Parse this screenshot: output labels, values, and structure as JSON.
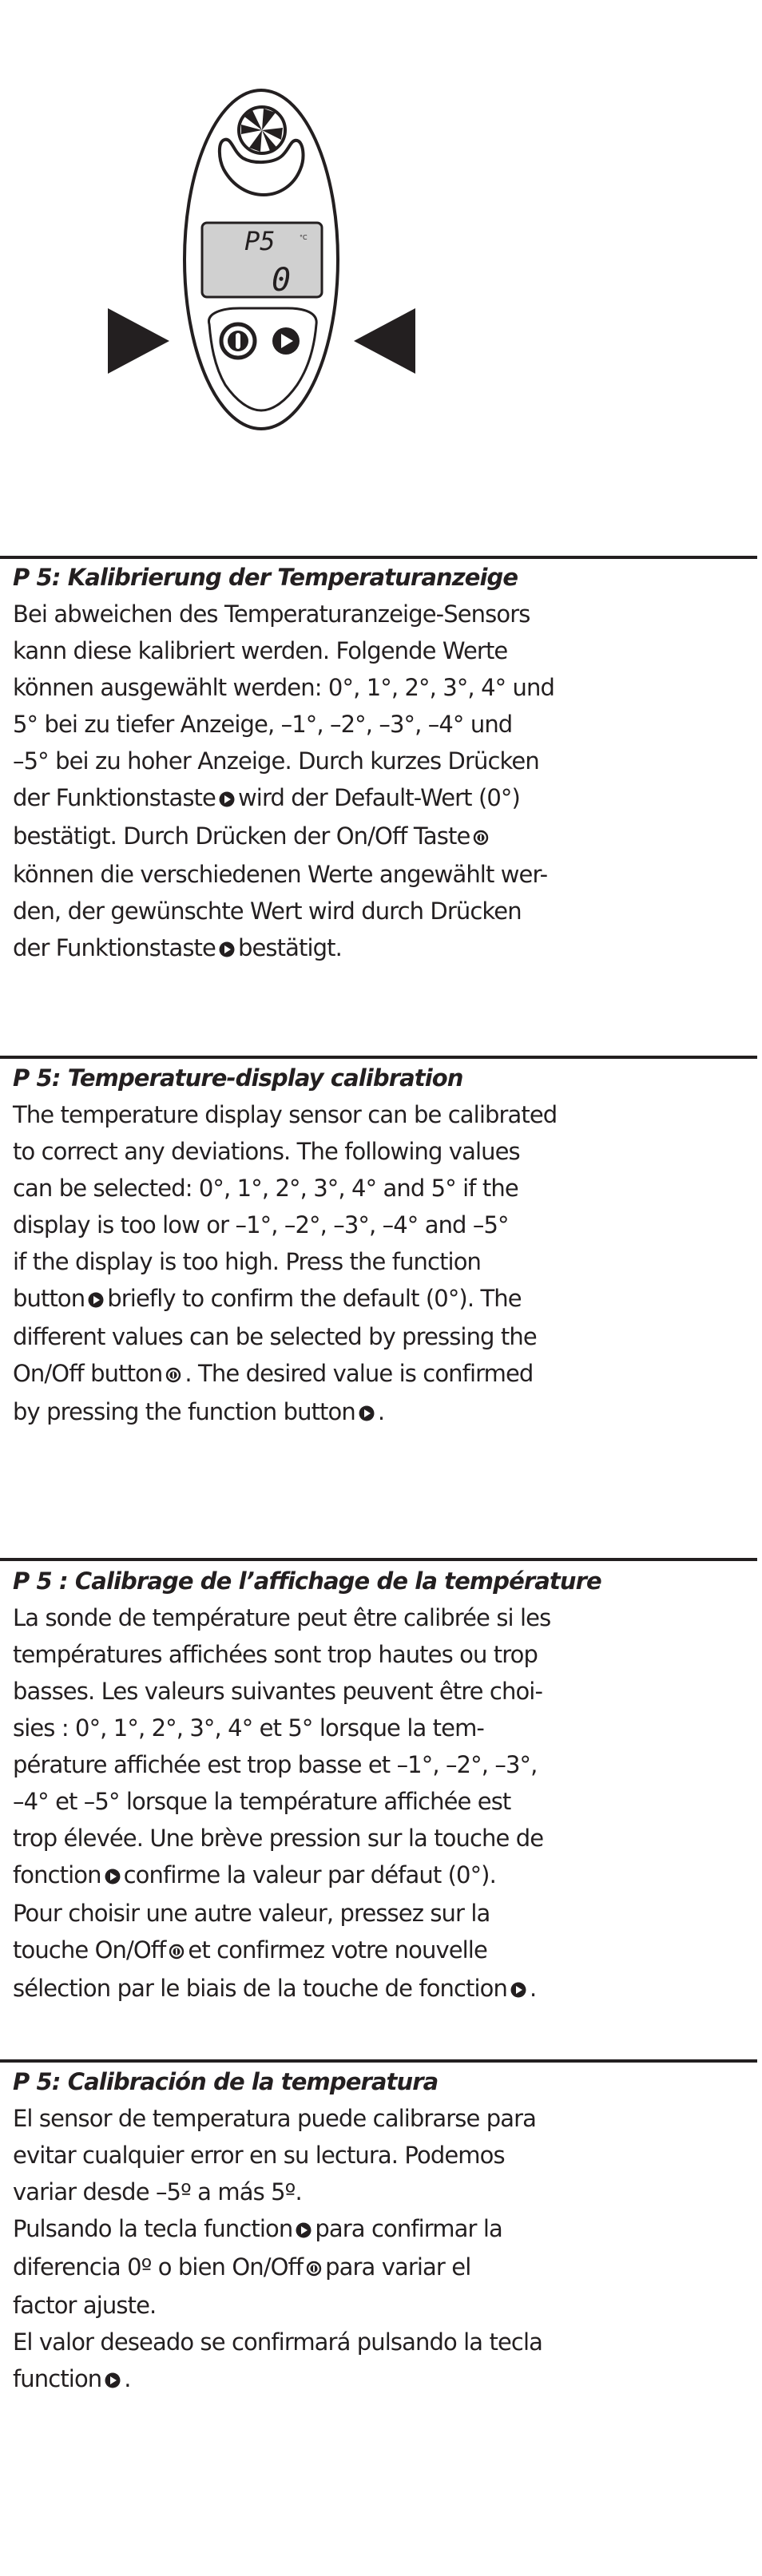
{
  "figure": {
    "lcd_top": "P5",
    "lcd_unit": "°C",
    "lcd_bottom": "0",
    "lcd_color": "#d0d0d0",
    "ink_color": "#231f20"
  },
  "icons": {
    "function_button": "function-button-icon",
    "onoff_button": "onoff-button-icon"
  },
  "sections": [
    {
      "lang": "de",
      "title": "P 5:  Kalibrierung der Temperaturanzeige",
      "lines": [
        [
          "Bei abweichen des Temperaturanzeige-Sensors"
        ],
        [
          "kann diese kalibriert werden. Folgende Werte"
        ],
        [
          "können ausgewählt werden: 0°, 1°, 2°, 3°, 4° und"
        ],
        [
          "5° bei zu tiefer Anzeige, –1°, –2°, –3°, –4° und"
        ],
        [
          "–5° bei zu hoher Anzeige. Durch kurzes Drücken"
        ],
        [
          "der Funktionstaste",
          "{fn}",
          "wird der Default-Wert (0°)"
        ],
        [
          "bestätigt. Durch Drücken der On/Off Taste",
          "{onoff}"
        ],
        [
          "können die verschiedenen Werte angewählt wer-"
        ],
        [
          "den, der gewünschte Wert wird durch Drücken"
        ],
        [
          "der Funktionstaste",
          "{fn}",
          "bestätigt."
        ]
      ]
    },
    {
      "lang": "en",
      "title": "P 5:  Temperature-display calibration",
      "lines": [
        [
          "The temperature display sensor can be calibrated"
        ],
        [
          "to correct any deviations. The following values"
        ],
        [
          "can be selected: 0°, 1°, 2°, 3°, 4° and 5° if the"
        ],
        [
          "display is too low or –1°, –2°, –3°, –4° and –5°"
        ],
        [
          "if the display is too high. Press the function"
        ],
        [
          "button",
          "{fn}",
          "briefly to confirm the default (0°). The"
        ],
        [
          "different values can be selected by pressing the"
        ],
        [
          "On/Off button",
          "{onoff}",
          ". The desired value is confirmed"
        ],
        [
          "by pressing the function button",
          "{fn}",
          "."
        ]
      ]
    },
    {
      "lang": "fr",
      "title": "P 5 : Calibrage de l’affichage de la température",
      "lines": [
        [
          "La sonde de température peut être calibrée si les"
        ],
        [
          "températures affichées sont trop hautes ou trop"
        ],
        [
          "basses. Les valeurs suivantes peuvent être choi-"
        ],
        [
          "sies : 0°, 1°, 2°, 3°, 4° et 5° lorsque la tem-"
        ],
        [
          "pérature affichée est trop basse et –1°, –2°, –3°,"
        ],
        [
          "–4° et –5° lorsque la température affichée est"
        ],
        [
          "trop élevée. Une brève pression sur la touche de"
        ],
        [
          "fonction",
          "{fn}",
          "confirme la valeur par défaut (0°)."
        ],
        [
          "Pour choisir une autre valeur, pressez sur la"
        ],
        [
          "touche On/Off",
          "{onoff}",
          "et confirmez votre nouvelle"
        ],
        [
          "sélection par le biais de la touche de fonction",
          "{fn}",
          "."
        ]
      ]
    },
    {
      "lang": "es",
      "title": "P 5:  Calibración de la temperatura",
      "lines": [
        [
          "El sensor de temperatura puede calibrarse para"
        ],
        [
          "evitar cualquier error en su lectura. Podemos"
        ],
        [
          "variar desde –5º a más 5º."
        ],
        [
          "Pulsando la tecla function",
          "{fn}",
          "para confirmar la"
        ],
        [
          "diferencia 0º o bien On/Off",
          "{onoff}",
          "para variar el"
        ],
        [
          "factor ajuste."
        ],
        [
          "El valor deseado se confirmará pulsando la tecla"
        ],
        [
          "function",
          "{fn}",
          "."
        ]
      ]
    }
  ]
}
